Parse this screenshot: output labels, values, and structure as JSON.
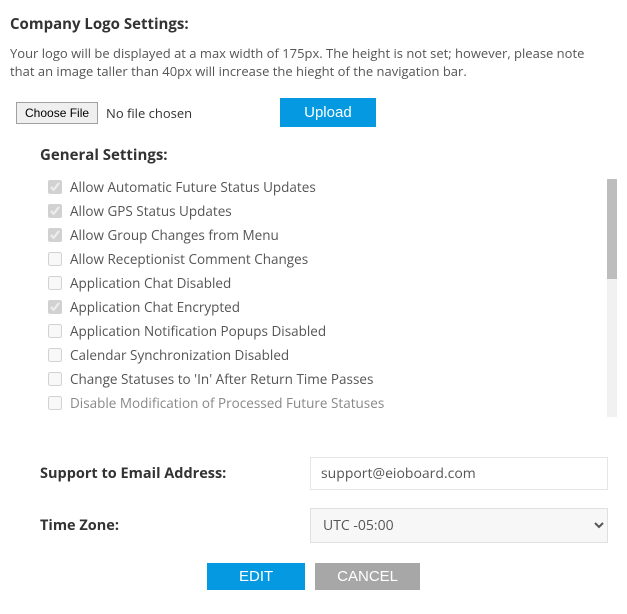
{
  "logoSection": {
    "title": "Company Logo Settings:",
    "description": "Your logo will be displayed at a max width of 175px. The height is not set; however, please note that an image taller than 40px will increase the hieght of the navigation bar.",
    "chooseFileLabel": "Choose File",
    "fileStatus": "No file chosen",
    "uploadLabel": "Upload"
  },
  "general": {
    "title": "General Settings:",
    "settings": [
      {
        "label": "Allow Automatic Future Status Updates",
        "checked": true
      },
      {
        "label": "Allow GPS Status Updates",
        "checked": true
      },
      {
        "label": "Allow Group Changes from Menu",
        "checked": true
      },
      {
        "label": "Allow Receptionist Comment Changes",
        "checked": false
      },
      {
        "label": "Application Chat Disabled",
        "checked": false
      },
      {
        "label": "Application Chat Encrypted",
        "checked": true
      },
      {
        "label": "Application Notification Popups Disabled",
        "checked": false
      },
      {
        "label": "Calendar Synchronization Disabled",
        "checked": false
      },
      {
        "label": "Change Statuses to 'In' After Return Time Passes",
        "checked": false
      },
      {
        "label": "Disable Modification of Processed Future Statuses",
        "checked": false
      }
    ]
  },
  "support": {
    "label": "Support to Email Address:",
    "value": "support@eioboard.com"
  },
  "timezone": {
    "label": "Time Zone:",
    "value": "UTC -05:00"
  },
  "actions": {
    "edit": "EDIT",
    "cancel": "CANCEL"
  }
}
